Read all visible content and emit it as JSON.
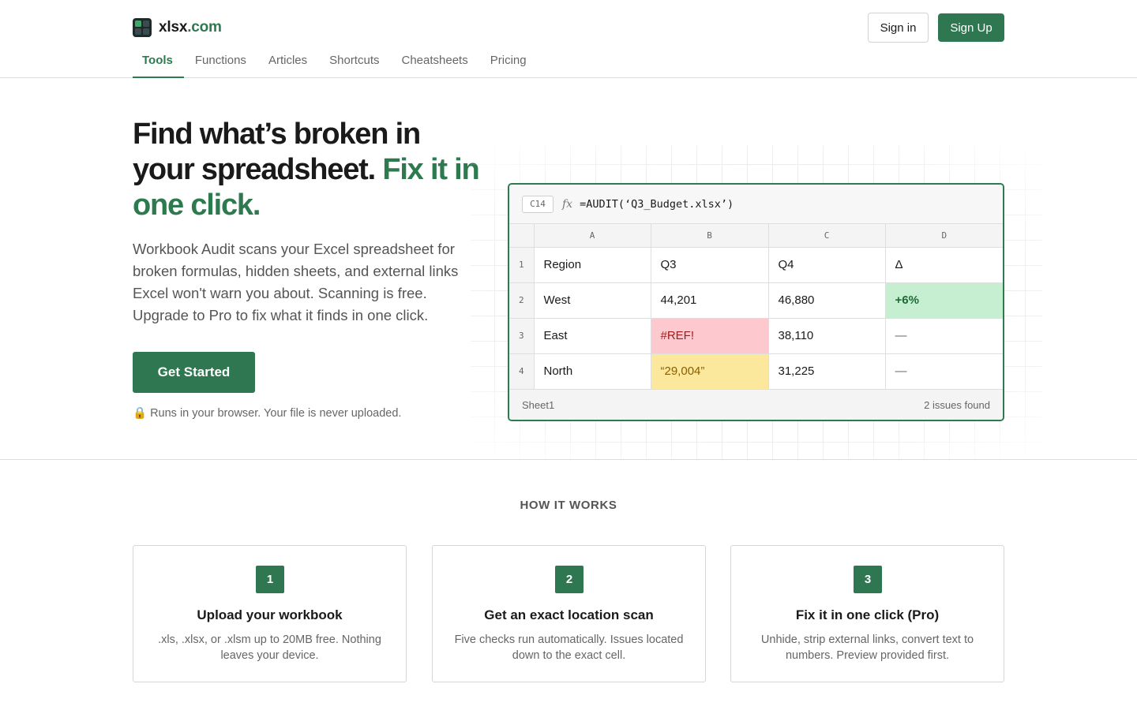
{
  "brand": {
    "name": "xlsx",
    "domain": ".com"
  },
  "header": {
    "signin_label": "Sign in",
    "signup_label": "Sign Up"
  },
  "nav": {
    "items": [
      {
        "label": "Tools",
        "active": true
      },
      {
        "label": "Functions"
      },
      {
        "label": "Articles"
      },
      {
        "label": "Shortcuts"
      },
      {
        "label": "Cheatsheets"
      },
      {
        "label": "Pricing"
      }
    ]
  },
  "hero": {
    "title_main": "Find what’s broken in your spreadsheet. ",
    "title_accent": "Fix it in one click.",
    "description": "Workbook Audit scans your Excel spreadsheet for broken formulas, hidden sheets, and external links Excel won't warn you about. Scanning is free. Upgrade to Pro to fix what it finds in one click.",
    "cta_label": "Get Started",
    "privacy_icon": "🔒",
    "privacy_text": "Runs in your browser. Your file is never uploaded."
  },
  "sheet": {
    "cell_ref": "C14",
    "fx_label": "fx",
    "formula": "=AUDIT(‘Q3_Budget.xlsx’)",
    "columns": [
      "A",
      "B",
      "C",
      "D"
    ],
    "rows": [
      {
        "num": "1",
        "cells": [
          "Region",
          "Q3",
          "Q4",
          "Δ"
        ]
      },
      {
        "num": "2",
        "cells": [
          "West",
          "44,201",
          "46,880",
          "+6%"
        ]
      },
      {
        "num": "3",
        "cells": [
          "East",
          "#REF!",
          "38,110",
          "—"
        ]
      },
      {
        "num": "4",
        "cells": [
          "North",
          "“29,004”",
          "31,225",
          "—"
        ]
      }
    ],
    "sheet_tab": "Sheet1",
    "issues": "2 issues found",
    "colors": {
      "good": "#c6eed0",
      "error": "#fdc9cf",
      "warning": "#fbe89c"
    }
  },
  "how": {
    "heading": "HOW IT WORKS",
    "steps": [
      {
        "num": "1",
        "title": "Upload your workbook",
        "desc": ".xls, .xlsx, or .xlsm up to 20MB free. Nothing leaves your device."
      },
      {
        "num": "2",
        "title": "Get an exact location scan",
        "desc": "Five checks run automatically. Issues located down to the exact cell."
      },
      {
        "num": "3",
        "title": "Fix it in one click (Pro)",
        "desc": "Unhide, strip external links, convert text to numbers. Preview provided first."
      }
    ]
  },
  "colors": {
    "accent": "#2d7a4f",
    "button": "#2e7750"
  }
}
